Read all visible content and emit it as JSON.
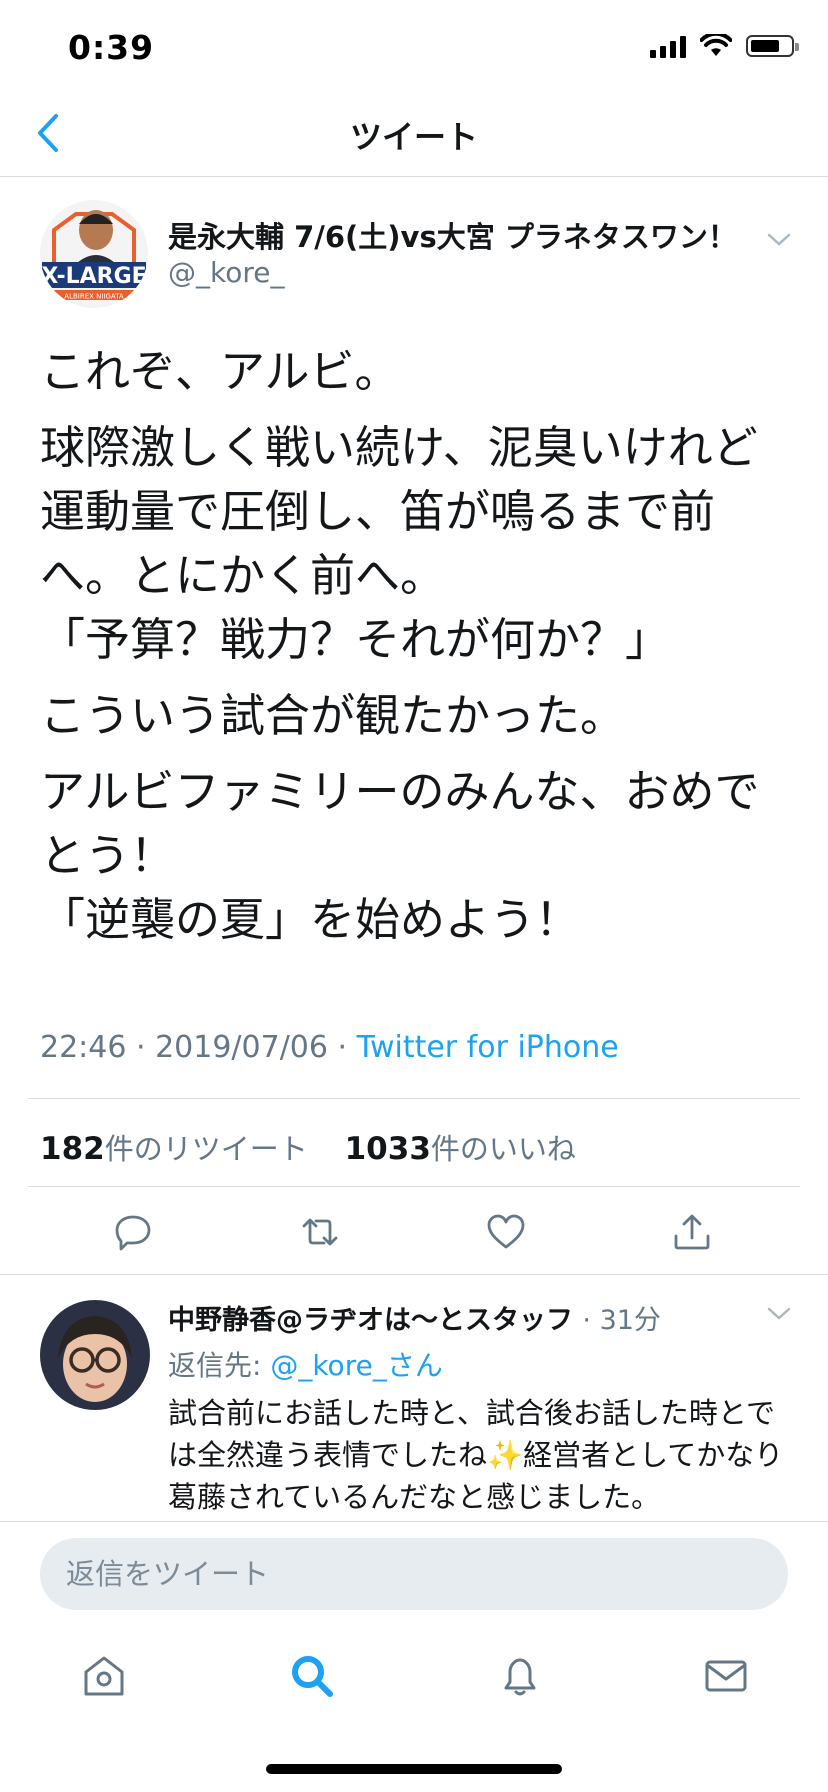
{
  "status_bar": {
    "time": "0:39"
  },
  "header": {
    "title": "ツイート",
    "back_icon": "chevron-left-icon"
  },
  "tweet": {
    "author_name": "是永大輔 7/6(土)vs大宮 プラネタスワン！",
    "author_handle": "@_kore_",
    "avatar_text": "X-LARGE",
    "avatar_subtext": "ALBIREX NIIGATA",
    "paragraphs": [
      "これぞ、アルビ。",
      "球際激しく戦い続け、泥臭いけれど運動量で圧倒し、笛が鳴るまで前へ。とにかく前へ。\n「予算？戦力？それが何か？」",
      "こういう試合が観たかった。",
      "アルビファミリーのみんな、おめでとう！\n「逆襲の夏」を始めよう！"
    ],
    "time": "22:46 · 2019/07/06 · ",
    "source": "Twitter for iPhone",
    "retweet_count": "182",
    "retweet_label": "件のリツイート",
    "like_count": "1033",
    "like_label": "件のいいね"
  },
  "reply": {
    "author_name": "中野静香@ラヂオは〜とスタッフ",
    "time": "· 31分",
    "reply_to_prefix": "返信先: ",
    "reply_to_handle": "@_kore_さん",
    "text": "試合前にお話した時と、試合後お話した時とでは全然違う表情でしたね✨経営者としてかなり葛藤されているんだなと感じました。"
  },
  "composer": {
    "placeholder": "返信をツイート"
  },
  "colors": {
    "accent": "#1da1f2",
    "secondary_text": "#657786",
    "primary_text": "#14171a",
    "divider": "#d8dde2"
  },
  "icons": {
    "actions": [
      "reply-icon",
      "retweet-icon",
      "like-icon",
      "share-icon"
    ],
    "tabs": [
      "home-icon",
      "search-icon",
      "notifications-icon",
      "messages-icon"
    ]
  }
}
